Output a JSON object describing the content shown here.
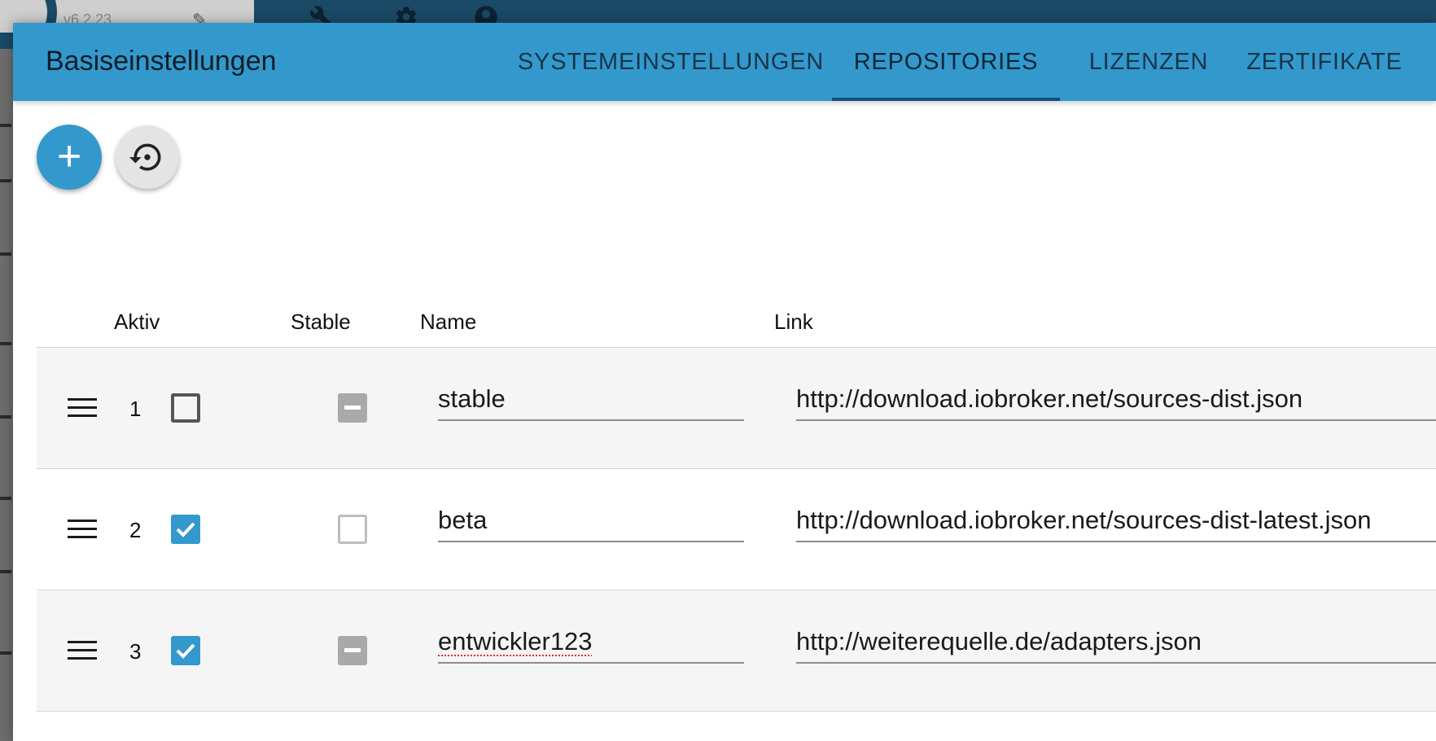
{
  "background": {
    "version": "v6.2.23",
    "pencil_glyph": "✎",
    "icons": [
      "wrench-icon",
      "gear-icon",
      "user-icon"
    ]
  },
  "dialog": {
    "title": "Basiseinstellungen",
    "tabs": [
      {
        "label": "SYSTEMEINSTELLUNGEN",
        "active": false
      },
      {
        "label": "REPOSITORIES",
        "active": true
      },
      {
        "label": "LIZENZEN",
        "active": false
      },
      {
        "label": "ZERTIFIKATE",
        "active": false
      }
    ]
  },
  "toolbar": {
    "add_symbol": "+",
    "restore_icon": "restore-icon"
  },
  "table": {
    "headers": {
      "active": "Aktiv",
      "stable": "Stable",
      "name": "Name",
      "link": "Link"
    },
    "rows": [
      {
        "num": "1",
        "active": false,
        "stable": "indeterminate",
        "name": "stable",
        "link": "http://download.iobroker.net/sources-dist.json"
      },
      {
        "num": "2",
        "active": true,
        "stable": "unchecked",
        "name": "beta",
        "link": "http://download.iobroker.net/sources-dist-latest.json"
      },
      {
        "num": "3",
        "active": true,
        "stable": "indeterminate",
        "name": "entwickler123",
        "link": "http://weiterequelle.de/adapters.json"
      }
    ]
  },
  "colors": {
    "accent": "#3399cc",
    "header_text": "#0f1d28",
    "tab_indicator": "#174f7a",
    "row_shade": "#f5f5f5"
  }
}
